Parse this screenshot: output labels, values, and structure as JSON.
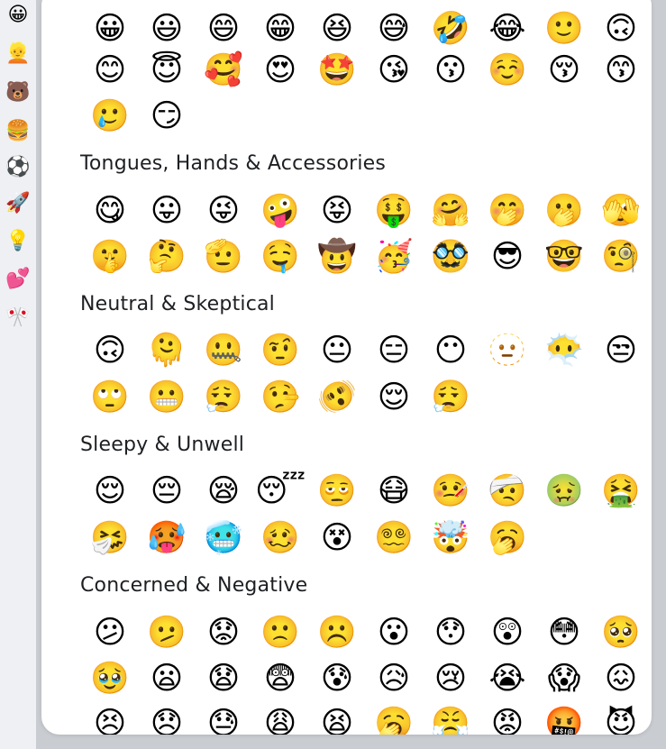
{
  "sidebar": {
    "items": [
      {
        "name": "smileys",
        "glyph": "😀"
      },
      {
        "name": "people",
        "glyph": "👱"
      },
      {
        "name": "animals-nature",
        "glyph": "🐻"
      },
      {
        "name": "food-drink",
        "glyph": "🍔"
      },
      {
        "name": "activity",
        "glyph": "⚽"
      },
      {
        "name": "travel-places",
        "glyph": "🚀"
      },
      {
        "name": "objects",
        "glyph": "💡"
      },
      {
        "name": "symbols",
        "glyph": "💕"
      },
      {
        "name": "flags",
        "glyph": "🎌"
      }
    ]
  },
  "sections": [
    {
      "key": "top",
      "title": "",
      "rows": [
        [
          "😀",
          "😃",
          "😄",
          "😁",
          "😆",
          "😅",
          "🤣",
          "😂",
          "🙂",
          "🙃"
        ],
        [
          "😊",
          "😇",
          "🥰",
          "😍",
          "🤩",
          "😘",
          "😗",
          "☺️",
          "😚",
          "😙"
        ],
        [
          "🥲",
          "😏"
        ]
      ]
    },
    {
      "key": "tongues",
      "title": "Tongues, Hands & Accessories",
      "rows": [
        [
          "😋",
          "😛",
          "😜",
          "🤪",
          "😝",
          "🤑",
          "🤗",
          "🤭",
          "🫢",
          "🫣"
        ],
        [
          "🤫",
          "🤔",
          "🫡",
          "🤤",
          "🤠",
          "🥳",
          "🥸",
          "😎",
          "🤓",
          "🧐"
        ]
      ]
    },
    {
      "key": "neutral",
      "title": "Neutral & Skeptical",
      "rows": [
        [
          "🙃",
          "🫠",
          "🤐",
          "🤨",
          "😐",
          "😑",
          "😶",
          "🫥",
          "😶‍🌫️",
          "😒"
        ],
        [
          "🙄",
          "😬",
          "😮‍💨",
          "🤥",
          "🫨",
          "😌",
          "😮‍💨"
        ]
      ]
    },
    {
      "key": "sleepy",
      "title": "Sleepy & Unwell",
      "rows": [
        [
          "😌",
          "😔",
          "😪",
          "😴",
          "🫩",
          "😷",
          "🤒",
          "🤕",
          "🤢",
          "🤮"
        ],
        [
          "🤧",
          "🥵",
          "🥶",
          "🥴",
          "😵",
          "😵‍💫",
          "🤯",
          "🥱"
        ]
      ]
    },
    {
      "key": "concerned",
      "title": "Concerned & Negative",
      "rows": [
        [
          "😕",
          "🫤",
          "😟",
          "🙁",
          "☹️",
          "😮",
          "😯",
          "😲",
          "😳",
          "🥺"
        ],
        [
          "🥹",
          "😦",
          "😧",
          "😨",
          "😰",
          "😥",
          "😢",
          "😭",
          "😱",
          "😖"
        ],
        [
          "😣",
          "😞",
          "😓",
          "😩",
          "😫",
          "🥱",
          "😤",
          "😡",
          "🤬",
          "😈"
        ]
      ]
    }
  ]
}
